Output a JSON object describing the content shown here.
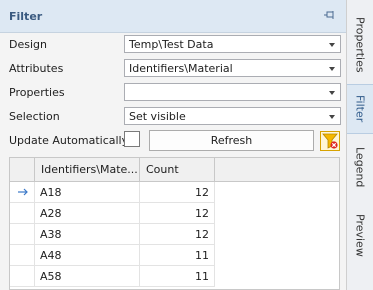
{
  "panel": {
    "title": "Filter",
    "pin_icon": "pin-icon"
  },
  "fields": {
    "design": {
      "label": "Design",
      "value": "Temp\\Test Data"
    },
    "attributes": {
      "label": "Attributes",
      "value": "Identifiers\\Material"
    },
    "properties": {
      "label": "Properties",
      "value": ""
    },
    "selection": {
      "label": "Selection",
      "value": "Set visible"
    },
    "update": {
      "label": "Update Automatically",
      "checked": false
    }
  },
  "buttons": {
    "refresh": "Refresh",
    "clear_filter_icon": "clear-filter-icon"
  },
  "grid": {
    "columns": [
      "Identifiers\\Mate...",
      "Count"
    ],
    "current_row_icon": "arrow-right-icon",
    "rows": [
      {
        "name": "A18",
        "count": "12"
      },
      {
        "name": "A28",
        "count": "12"
      },
      {
        "name": "A38",
        "count": "12"
      },
      {
        "name": "A48",
        "count": "11"
      },
      {
        "name": "A58",
        "count": "11"
      }
    ]
  },
  "side_tabs": [
    {
      "label": "Properties",
      "active": false
    },
    {
      "label": "Filter",
      "active": true
    },
    {
      "label": "Legend",
      "active": false
    },
    {
      "label": "Preview",
      "active": false
    }
  ],
  "colors": {
    "title_bar": "#dde8f3",
    "accent": "#3a78c8",
    "filter_icon": "#f5b800"
  }
}
